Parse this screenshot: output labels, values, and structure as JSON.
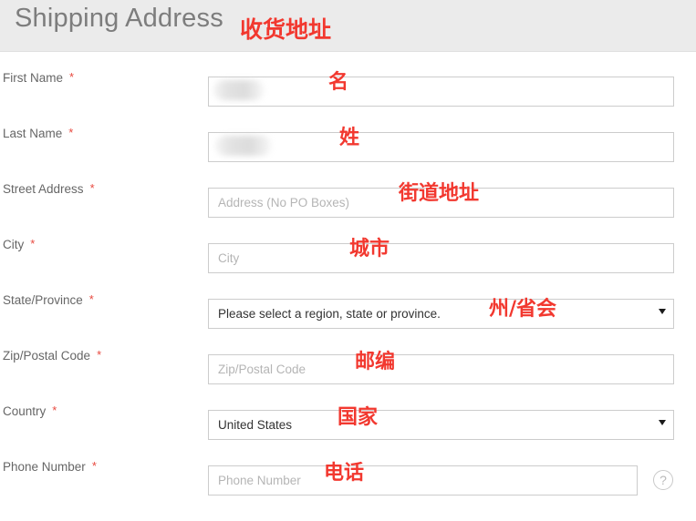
{
  "header": {
    "title": "Shipping Address",
    "annotation": "收货地址"
  },
  "colors": {
    "header_bg": "#ebebeb",
    "title_text": "#7d7d7d",
    "label_text": "#666666",
    "required_star": "#e8493f",
    "annotation_red": "#f2382f",
    "input_border": "#cccccc",
    "placeholder": "#b5b5b5"
  },
  "required_marker": "*",
  "fields": [
    {
      "label": "First Name",
      "required": true,
      "type": "text",
      "value": "",
      "placeholder": "",
      "redacted": true,
      "annotation": "名"
    },
    {
      "label": "Last Name",
      "required": true,
      "type": "text",
      "value": "",
      "placeholder": "",
      "redacted": true,
      "annotation": "姓"
    },
    {
      "label": "Street Address",
      "required": true,
      "type": "text",
      "value": "",
      "placeholder": "Address (No PO Boxes)",
      "redacted": false,
      "annotation": "街道地址"
    },
    {
      "label": "City",
      "required": true,
      "type": "text",
      "value": "",
      "placeholder": "City",
      "redacted": false,
      "annotation": "城市"
    },
    {
      "label": "State/Province",
      "required": true,
      "type": "select",
      "value": "Please select a region, state or province.",
      "options": [
        "Please select a region, state or province."
      ],
      "annotation": "州/省会"
    },
    {
      "label": "Zip/Postal Code",
      "required": true,
      "type": "text",
      "value": "",
      "placeholder": "Zip/Postal Code",
      "redacted": false,
      "annotation": "邮编"
    },
    {
      "label": "Country",
      "required": true,
      "type": "select",
      "value": "United States",
      "options": [
        "United States"
      ],
      "annotation": "国家"
    },
    {
      "label": "Phone Number",
      "required": true,
      "type": "text",
      "value": "",
      "placeholder": "Phone Number",
      "redacted": false,
      "annotation": "电话",
      "help_icon": "?"
    }
  ]
}
